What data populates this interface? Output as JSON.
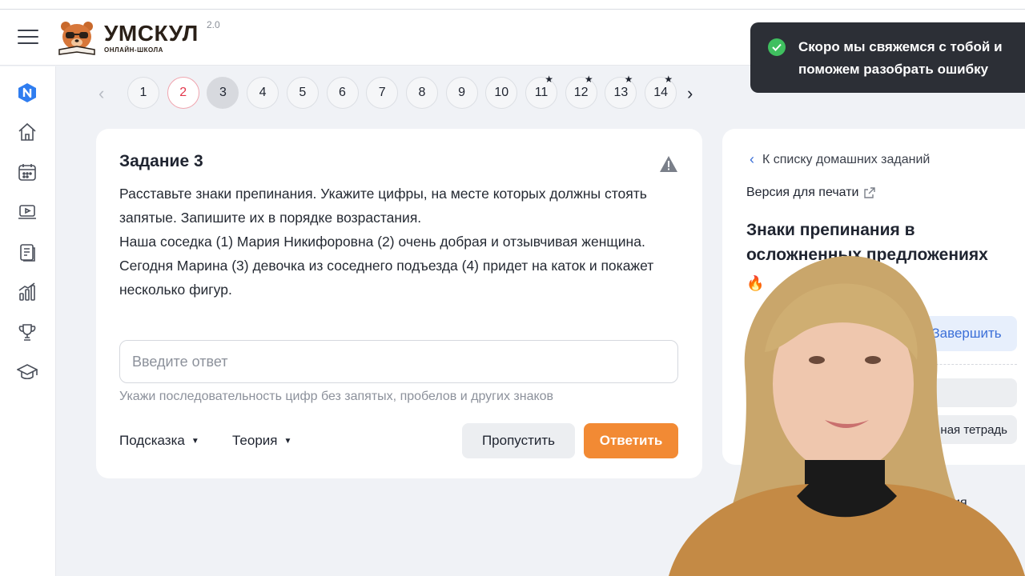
{
  "app": {
    "logo_main": "УМСКУЛ",
    "logo_sub": "ОНЛАЙН-ШКОЛА",
    "logo_version": "2.0"
  },
  "sidebar": {
    "items": [
      {
        "icon": "brand-n-icon"
      },
      {
        "icon": "home-icon"
      },
      {
        "icon": "calendar-icon"
      },
      {
        "icon": "video-lesson-icon"
      },
      {
        "icon": "homework-icon"
      },
      {
        "icon": "stats-icon"
      },
      {
        "icon": "trophy-icon"
      },
      {
        "icon": "graduation-cap-icon"
      }
    ]
  },
  "pager": {
    "pages": [
      {
        "label": "1",
        "state": "normal",
        "star": false
      },
      {
        "label": "2",
        "state": "error",
        "star": false
      },
      {
        "label": "3",
        "state": "current",
        "star": false
      },
      {
        "label": "4",
        "state": "normal",
        "star": false
      },
      {
        "label": "5",
        "state": "normal",
        "star": false
      },
      {
        "label": "6",
        "state": "normal",
        "star": false
      },
      {
        "label": "7",
        "state": "normal",
        "star": false
      },
      {
        "label": "8",
        "state": "normal",
        "star": false
      },
      {
        "label": "9",
        "state": "normal",
        "star": false
      },
      {
        "label": "10",
        "state": "normal",
        "star": false
      },
      {
        "label": "11",
        "state": "normal",
        "star": true
      },
      {
        "label": "12",
        "state": "normal",
        "star": true
      },
      {
        "label": "13",
        "state": "normal",
        "star": true
      },
      {
        "label": "14",
        "state": "normal",
        "star": true
      }
    ],
    "prev": "‹",
    "next": "›",
    "star_glyph": "★"
  },
  "task": {
    "title": "Задание 3",
    "text": [
      "Расставьте знаки препинания. Укажите цифры, на месте которых должны стоять запятые. Запишите их в порядке возрастания.",
      "Наша соседка (1) Мария Никифоровна (2) очень добрая и отзывчивая женщина.",
      "Сегодня Марина (3) девочка из соседнего подъезда (4) придет на каток и покажет несколько фигур."
    ],
    "input_placeholder": "Введите ответ",
    "input_value": "",
    "input_hint": "Укажи последовательность цифр без запятых, пробелов и других знаков",
    "hint_label": "Подсказка",
    "theory_label": "Теория",
    "skip_label": "Пропустить",
    "answer_label": "Ответить"
  },
  "right_panel": {
    "back_label": "К списку домашних заданий",
    "print_label": "Версия для печати",
    "title": "Знаки препинания в осложненных предложениях",
    "finish_label": "Завершить",
    "notebook_label": "ная тетрадь",
    "bottom_label": "ия"
  },
  "toast": {
    "text": "Скоро мы свяжемся с тобой и поможем разобрать ошибку"
  },
  "colors": {
    "accent_orange": "#f28a34",
    "link_blue": "#3b6fd8",
    "error_red": "#e2364b",
    "success_green": "#3fbf5f",
    "toast_bg": "#2c2f36"
  }
}
